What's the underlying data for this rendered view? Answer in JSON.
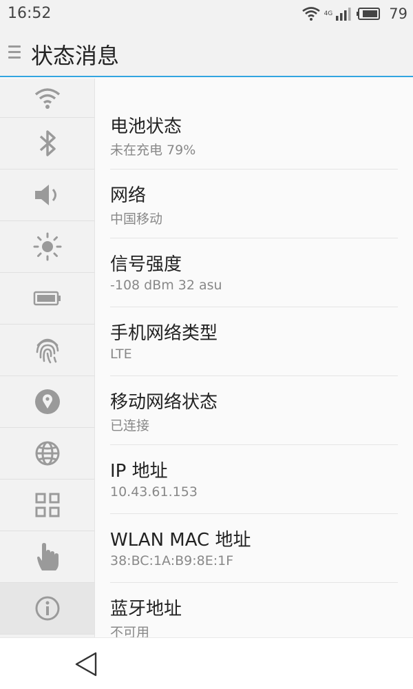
{
  "status_bar": {
    "time": "16:52",
    "network_label": "4G",
    "battery_percent": "79",
    "icons": [
      "wifi-icon",
      "signal-icon",
      "battery-icon"
    ]
  },
  "header": {
    "title": "状态消息",
    "menu_icon": "menu-icon"
  },
  "sidebar": {
    "items": [
      {
        "icon": "wifi-icon"
      },
      {
        "icon": "bluetooth-icon"
      },
      {
        "icon": "volume-icon"
      },
      {
        "icon": "brightness-icon"
      },
      {
        "icon": "battery-icon"
      },
      {
        "icon": "fingerprint-icon"
      },
      {
        "icon": "location-icon"
      },
      {
        "icon": "globe-icon"
      },
      {
        "icon": "apps-grid-icon"
      },
      {
        "icon": "gesture-hand-icon"
      },
      {
        "icon": "info-icon",
        "active": true
      }
    ]
  },
  "content": {
    "rows": [
      {
        "title": "电池状态",
        "value": "未在充电   79%"
      },
      {
        "title": "网络",
        "value": "中国移动"
      },
      {
        "title": "信号强度",
        "value": "-108 dBm   32 asu"
      },
      {
        "title": "手机网络类型",
        "value": "LTE"
      },
      {
        "title": "移动网络状态",
        "value": "已连接"
      },
      {
        "title": "IP 地址",
        "value": "10.43.61.153"
      },
      {
        "title": "WLAN MAC 地址",
        "value": "38:BC:1A:B9:8E:1F"
      },
      {
        "title": "蓝牙地址",
        "value": "不可用"
      }
    ]
  },
  "nav_bar": {
    "back_icon": "back-triangle-icon"
  },
  "colors": {
    "accent": "#32a5e0",
    "icon_gray": "#9a9a9a",
    "background": "#fafafa",
    "sidebar_bg": "#f2f2f2"
  }
}
